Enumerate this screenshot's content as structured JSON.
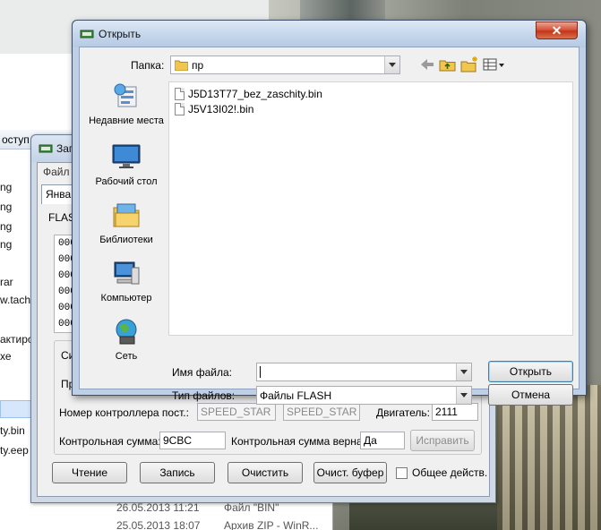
{
  "explorer": {
    "header_label": "оступ",
    "items": [
      "ng",
      "ng",
      "ng",
      "ng",
      "rar",
      "w.tach",
      "актиро",
      "хе",
      "ty.bin",
      "ty.eep"
    ],
    "rows": [
      {
        "date": "26.05.2013 11:21",
        "type": "Файл \"BIN\""
      },
      {
        "date": "25.05.2013 18:07",
        "type": "Архив ZIP - WinR..."
      }
    ]
  },
  "programmer": {
    "title": "Зап",
    "menu": "Файл",
    "tab": "Январ",
    "flash_label": "FLAS",
    "hex_lines": [
      "000",
      "000",
      "000",
      "000",
      "000",
      "000"
    ],
    "group_labels": {
      "si": "Си",
      "pr": "Пр"
    },
    "controller_label": "Номер контроллера пост.:",
    "controller_value": "SPEED_STAR",
    "controller_value2": "SPEED_STAR",
    "engine_label": "Двигатель:",
    "engine_value": "2111",
    "checksum_label": "Контрольная сумма:",
    "checksum_value": "9CBC",
    "checksum_ok_label": "Контрольная сумма верна:",
    "checksum_ok_value": "Да",
    "fix_button": "Исправить",
    "buttons": {
      "read": "Чтение",
      "write": "Запись",
      "clear": "Очистить",
      "clear_buffer": "Очист. буфер"
    },
    "common_action": "Общее действ."
  },
  "dialog": {
    "title": "Открыть",
    "close_symbol": "✕",
    "folder_label": "Папка:",
    "folder_value": "пр",
    "places": [
      {
        "label": "Недавние места",
        "icon": "recent-places-icon"
      },
      {
        "label": "Рабочий стол",
        "icon": "desktop-icon"
      },
      {
        "label": "Библиотеки",
        "icon": "libraries-icon"
      },
      {
        "label": "Компьютер",
        "icon": "computer-icon"
      },
      {
        "label": "Сеть",
        "icon": "network-icon"
      }
    ],
    "files": [
      "J5D13T77_bez_zaschity.bin",
      "J5V13I02!.bin"
    ],
    "filename_label": "Имя файла:",
    "filename_value": "",
    "filetype_label": "Тип файлов:",
    "filetype_value": "Файлы FLASH",
    "open_button": "Открыть",
    "cancel_button": "Отмена"
  }
}
